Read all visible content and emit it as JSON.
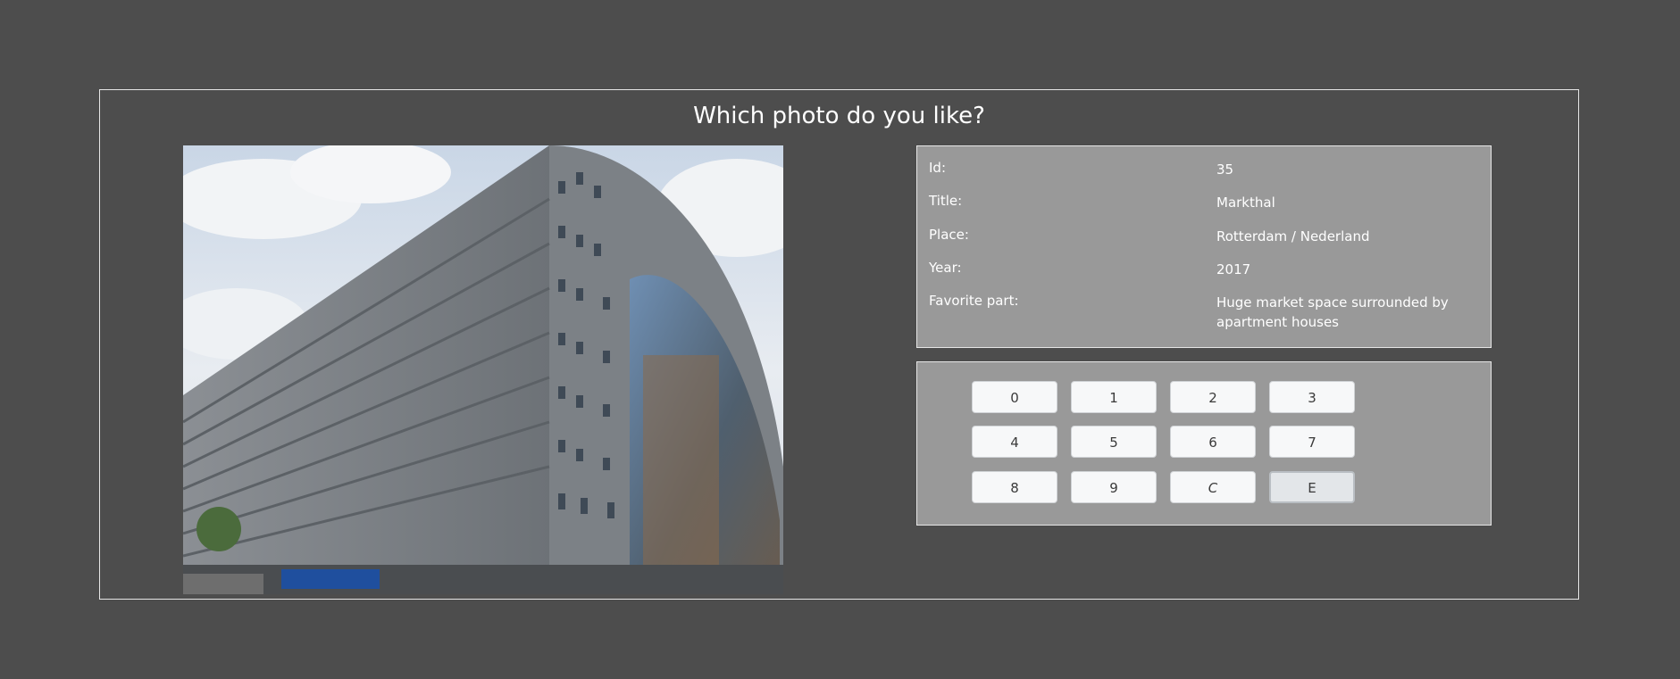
{
  "page": {
    "heading": "Which photo do you like?"
  },
  "photo": {
    "subject": "Markthal building photo"
  },
  "info": {
    "rows": [
      {
        "label": "Id:",
        "value": "35"
      },
      {
        "label": "Title:",
        "value": "Markthal"
      },
      {
        "label": "Place:",
        "value": "Rotterdam / Nederland"
      },
      {
        "label": "Year:",
        "value": "2017"
      },
      {
        "label": "Favorite part:",
        "value": "Huge market space surrounded by apartment houses"
      }
    ]
  },
  "keypad": {
    "keys": [
      "0",
      "1",
      "2",
      "3",
      "4",
      "5",
      "6",
      "7",
      "8",
      "9",
      "C",
      "E"
    ],
    "active_key": "E"
  },
  "colors": {
    "background": "#4d4d4d",
    "panel": "#999999",
    "border": "#e6e6e6",
    "key": "#f7f8f9"
  }
}
